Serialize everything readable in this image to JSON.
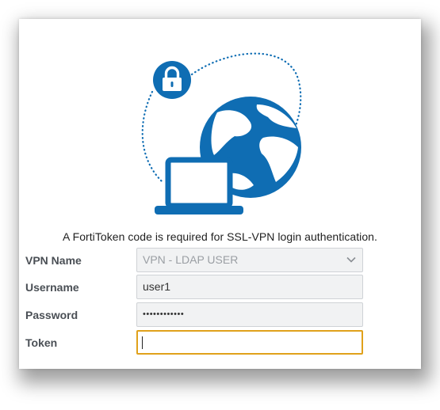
{
  "notice": "A FortiToken code is required for SSL-VPN login authentication.",
  "form": {
    "vpn_name": {
      "label": "VPN Name",
      "value": "VPN - LDAP USER"
    },
    "username": {
      "label": "Username",
      "value": "user1"
    },
    "password": {
      "label": "Password",
      "value": "••••••••••••"
    },
    "token": {
      "label": "Token",
      "value": ""
    }
  },
  "colors": {
    "brand_blue": "#0f6db3",
    "focus_border": "#e0a11b"
  },
  "icons": [
    "lock-icon",
    "globe-icon",
    "laptop-icon",
    "chevron-down-icon"
  ]
}
